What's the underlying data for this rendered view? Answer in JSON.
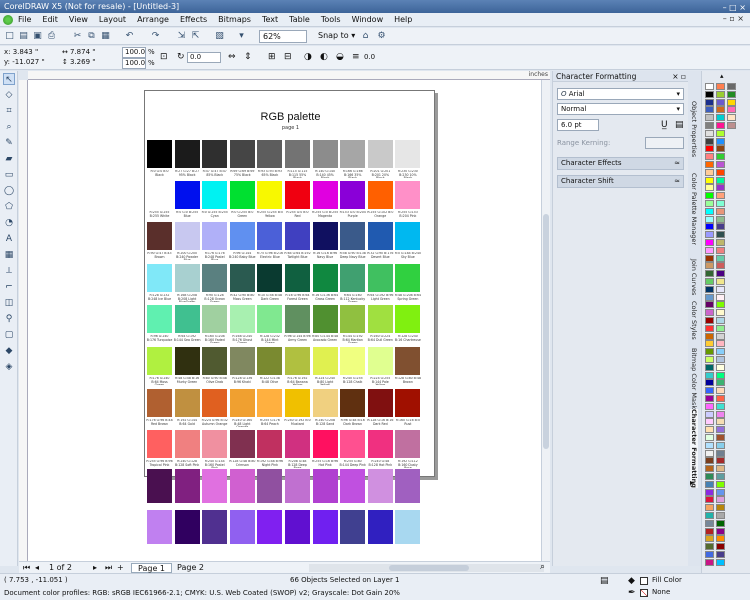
{
  "window": {
    "title": "CorelDRAW X5 (Not for resale) - [Untitled-3]",
    "controls": "– □ ×"
  },
  "menu": [
    "File",
    "Edit",
    "View",
    "Layout",
    "Arrange",
    "Effects",
    "Bitmaps",
    "Text",
    "Table",
    "Tools",
    "Window",
    "Help"
  ],
  "menu_winbtns": "– ▫ ×",
  "toolbar": {
    "zoom": "62%",
    "snap": "Snap to"
  },
  "propbar": {
    "x": "x: 3.843 \"",
    "y": "y: -11.027 \"",
    "w": "7.874 \"",
    "h": "3.269 \"",
    "sx": "100.0",
    "sy": "100.0",
    "pct1": "%",
    "pct2": "%",
    "angle": "0.0",
    "outline": "0.0"
  },
  "ruler_unit": "inches",
  "document": {
    "title": "RGB palette",
    "subtitle": "page 1",
    "rows": [
      [
        "#000000",
        "#1b1b1b",
        "#2f2f2f",
        "#454545",
        "#5d5d5d",
        "#737373",
        "#8c8c8c",
        "#a6a6a6",
        "#c9c9c9",
        "#e6e6e6"
      ],
      [
        "#ffffff",
        "#0010ee",
        "#00f2f2",
        "#00e030",
        "#f8f800",
        "#f00010",
        "#e000e0",
        "#8a00d8",
        "#ff6000",
        "#ff90c8"
      ],
      [
        "#5a2f2b",
        "#c8c8f0",
        "#b0b0f8",
        "#6090f0",
        "#4b60d8",
        "#4040c0",
        "#101060",
        "#3a5a8a",
        "#205ab0",
        "#00b8f0"
      ],
      [
        "#80e8f8",
        "#a8d0d0",
        "#5a8080",
        "#2a5a50",
        "#0a3a30",
        "#106040",
        "#108840",
        "#40a070",
        "#40c060",
        "#30d040"
      ],
      [
        "#60f0b0",
        "#40c090",
        "#a0d0a0",
        "#a8f0b0",
        "#80e890",
        "#609060",
        "#509030",
        "#90c040",
        "#a0e040",
        "#80f010"
      ],
      [
        "#b0f040",
        "#303010",
        "#505a30",
        "#808860",
        "#7a8a30",
        "#b0c040",
        "#e0f050",
        "#f0ff80",
        "#e0ff90",
        "#805030"
      ],
      [
        "#b06030",
        "#c09040",
        "#e06020",
        "#f0a030",
        "#ffb040",
        "#f0c000",
        "#f0d080",
        "#603010",
        "#801010",
        "#a01000"
      ],
      [
        "#ff6060",
        "#f08080",
        "#f090a0",
        "#803050",
        "#c03060",
        "#d03080",
        "#ff1060",
        "#ff5090",
        "#f03080",
        "#c070a0"
      ],
      [
        "#4a1050",
        "#802080",
        "#e070e0",
        "#d060d0",
        "#9050a0",
        "#c070d0",
        "#b040d0",
        "#c050e0",
        "#d090e0",
        "#a060c0"
      ],
      [
        "#c080f0",
        "#300060",
        "#503090",
        "#9060f0",
        "#8020f0",
        "#6010d0",
        "#7020f0",
        "#404090",
        "#3020c0",
        "#a8d8f0"
      ]
    ],
    "labels": [
      [
        "R:0 G:0 B:0 Black",
        "R:27 G:27 B:27 95% Black",
        "R:47 G:47 B:47 85% Black",
        "R:69 G:69 B:69 75% Black",
        "R:93 G:93 B:93 65% Black",
        "R:115 G:115 B:115 55% Black",
        "R:140 G:140 B:140 45% Black",
        "R:166 G:166 B:166 35% Black",
        "R:201 G:201 B:201 20% Black",
        "R:230 G:230 B:230 10% Black"
      ],
      [
        "R:255 G:255 B:255 White",
        "R:0 G:0 B:255 Blue",
        "R:0 G:255 B:255 Cyan",
        "R:0 G:255 B:0 Green",
        "R:255 G:255 B:0 Yellow",
        "R:255 G:0 B:0 Red",
        "R:255 G:0 B:255 Magenta",
        "R:153 G:0 B:204 Purple",
        "R:255 G:102 B:0 Orange",
        "R:255 G:153 B:204 Pink"
      ],
      [
        "R:90 G:47 B:43 Brown",
        "R:200 G:200 B:240 Powder Blue",
        "R:176 G:176 B:248 Pastel Blue",
        "R:96 G:144 B:240 Baby Blue",
        "R:75 G:96 B:216 Electric Blue",
        "R:64 G:64 B:192 Twilight Blue",
        "R:16 G:16 B:96 Navy Blue",
        "R:58 G:90 B:138 Deep Navy Blue",
        "R:32 G:90 B:176 Desert Blue",
        "R:0 G:184 B:240 Sky Blue"
      ],
      [
        "R:128 G:232 B:248 Ice Blue",
        "R:168 G:208 B:208 Light BlueGreen",
        "R:90 G:128 B:128 Ocean Green",
        "R:42 G:90 B:80 Moss Green",
        "R:10 G:58 B:48 Dark Green",
        "R:16 G:96 B:64 Forest Green",
        "R:16 G:136 B:64 Grass Green",
        "R:64 G:160 B:112 Kentucky Green",
        "R:64 G:192 B:96 Light Green",
        "R:48 G:208 B:64 Spring Green"
      ],
      [
        "R:96 G:240 B:176 Turquoise",
        "R:64 G:192 B:144 Sea Green",
        "R:160 G:208 B:160 Faded Green",
        "R:168 G:240 B:176 Ghost Green",
        "R:128 G:232 B:144 Mint Green",
        "R:96 G:144 B:96 Army Green",
        "R:80 G:144 B:48 Avocado Green",
        "R:144 G:192 B:64 Martian Green",
        "R:160 G:224 B:64 Dull Green",
        "R:128 G:240 B:16 Chartreuse"
      ],
      [
        "R:176 G:240 B:64 Moss Green",
        "R:48 G:48 B:16 Murky Green",
        "R:80 G:90 B:48 Olive Drab",
        "R:128 G:136 B:96 Khaki",
        "R:122 G:138 B:48 Olive",
        "R:176 G:192 B:64 Banana Yellow",
        "R:224 G:240 B:80 Light Yellow",
        "R:240 G:255 B:128 Chalk",
        "R:224 G:255 B:144 Pale Yellow",
        "R:128 G:80 B:48 Brown"
      ],
      [
        "R:176 G:96 B:48 Red Brown",
        "R:192 G:144 B:64 Gold",
        "R:224 G:96 B:32 Autumn Orange",
        "R:240 G:160 B:48 Light Orange",
        "R:255 G:176 B:64 Peach",
        "R:240 G:192 B:0 Mustard",
        "R:240 G:208 B:128 Sand",
        "R:96 G:48 B:16 Dark Brown",
        "R:128 G:16 B:16 Dark Red",
        "R:160 G:16 B:0 Rust"
      ],
      [
        "R:255 G:96 B:96 Tropical Pink",
        "R:240 G:128 B:128 Soft Pink",
        "R:240 G:144 B:160 Pastel Pink",
        "R:128 G:48 B:80 Crimson",
        "R:192 G:48 B:96 Night Pink",
        "R:208 G:48 B:128 Deep Rose",
        "R:255 G:16 B:96 Hot Pink",
        "R:255 G:80 B:144 Deep Pink",
        "R:240 G:48 B:128 Hot Pink",
        "R:192 G:112 B:160 Dusty Rose"
      ],
      [
        "",
        "",
        "",
        "",
        "",
        "",
        "",
        "",
        "",
        ""
      ],
      [
        "",
        "",
        "",
        "",
        "",
        "",
        "",
        "",
        "",
        ""
      ]
    ]
  },
  "pages": {
    "counter": "1 of 2",
    "tab1": "Page 1",
    "tab2": "Page 2"
  },
  "status": {
    "coords": "( 7.753 , -11.051 )",
    "center": "66 Objects Selected on Layer 1",
    "profiles": "Document color profiles: RGB: sRGB IEC61966-2.1; CMYK: U.S. Web Coated (SWOP) v2; Grayscale: Dot Gain 20%",
    "fill_label": "Fill Color",
    "outline_label": "None"
  },
  "docker": {
    "title": "Character Formatting",
    "font": "Arial",
    "style": "Normal",
    "size": "6.0 pt",
    "range_kerning": "Range Kerning:",
    "sections": [
      "Character Effects",
      "Character Shift"
    ]
  },
  "docker_tabs": [
    "Object Properties",
    "Color Palette Manager",
    "Join Curves",
    "Color Styles",
    "Bitmap Color Mask",
    "Character Formatting"
  ],
  "palette_colors": [
    "#ffffff",
    "#000000",
    "#1a2e8c",
    "#3d5fbf",
    "#c0c0c0",
    "#808080",
    "#e0e0e0",
    "#404040",
    "#ff0000",
    "#ff8080",
    "#ff6600",
    "#ffcc99",
    "#ffff00",
    "#ffff99",
    "#00ff00",
    "#99ff99",
    "#00ffff",
    "#99ffff",
    "#0000ff",
    "#9999ff",
    "#ff00ff",
    "#ff99ff",
    "#993300",
    "#cc9966",
    "#336633",
    "#66cc66",
    "#003366",
    "#6699cc",
    "#660066",
    "#cc66cc",
    "#990000",
    "#ff3333",
    "#cc6600",
    "#ffcc33",
    "#669900",
    "#ccff66",
    "#006666",
    "#33cccc",
    "#000099",
    "#3366ff",
    "#990099",
    "#ff66ff",
    "#ccccff",
    "#ffccff",
    "#ffe0b0",
    "#e0ffe0",
    "#b0e0ff",
    "#f0f0f0",
    "#7a3e1e",
    "#b5651d",
    "#2e8b57",
    "#4682b4",
    "#8a2be2",
    "#dc143c",
    "#f4a460",
    "#20b2aa",
    "#778899",
    "#b22222",
    "#daa520",
    "#556b2f",
    "#4169e1",
    "#c71585",
    "#ff7f50",
    "#9acd32",
    "#6a5acd",
    "#d2691e",
    "#00ced1",
    "#ff1493",
    "#adff2f",
    "#1e90ff",
    "#8b4513",
    "#32cd32",
    "#ba55d3",
    "#ff4500",
    "#00fa9a",
    "#9932cc",
    "#ffa07a",
    "#7fffd4",
    "#e9967a",
    "#8fbc8f",
    "#483d8b",
    "#2f4f4f",
    "#bdb76b",
    "#f08080",
    "#66cdaa",
    "#cd5c5c",
    "#4b0082",
    "#f0e68c",
    "#e6e6fa",
    "#fff0f5",
    "#7cfc00",
    "#fffacd",
    "#add8e6",
    "#90ee90",
    "#d3d3d3",
    "#ffb6c1",
    "#87cefa",
    "#b0c4de",
    "#ffffe0",
    "#00ff7f",
    "#3cb371",
    "#ffdab9",
    "#ff6347",
    "#40e0d0",
    "#ee82ee",
    "#f5deb3",
    "#9370db",
    "#a0522d",
    "#87ceeb",
    "#708090",
    "#a52a2a",
    "#deb887",
    "#5f9ea0",
    "#7fff00",
    "#6495ed",
    "#dda0dd",
    "#b8860b",
    "#a9a9a9",
    "#006400",
    "#8b008b",
    "#ff8c00",
    "#8b0000",
    "#483d8b",
    "#00bfff",
    "#696969",
    "#228b22",
    "#ffd700",
    "#ff69b4",
    "#ffe4c4",
    "#bc8f8f"
  ]
}
